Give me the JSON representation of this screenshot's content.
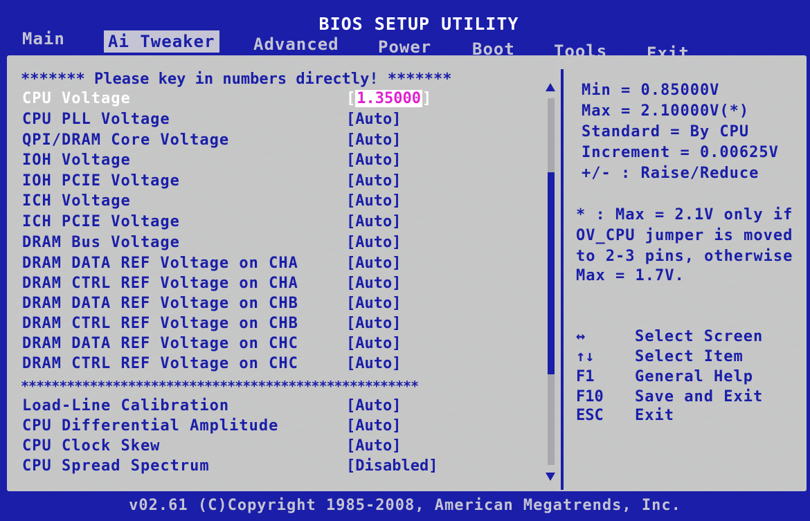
{
  "app": {
    "title": "BIOS SETUP UTILITY",
    "footer": "v02.61 (C)Copyright 1985-2008, American Megatrends, Inc."
  },
  "menu": {
    "items": [
      {
        "label": "Main"
      },
      {
        "label": "Ai Tweaker"
      },
      {
        "label": "Advanced"
      },
      {
        "label": "Power"
      },
      {
        "label": "Boot"
      },
      {
        "label": "Tools"
      },
      {
        "label": "Exit"
      }
    ],
    "active": "Ai Tweaker"
  },
  "settings": {
    "hint": "******* Please key in numbers directly! *******",
    "separator": "****************************************************",
    "voltage_rows": [
      {
        "label": "CPU Voltage",
        "value": "1.35000",
        "selected": true
      },
      {
        "label": "CPU PLL Voltage",
        "value": "[Auto]"
      },
      {
        "label": "QPI/DRAM Core Voltage",
        "value": "[Auto]"
      },
      {
        "label": "IOH Voltage",
        "value": "[Auto]"
      },
      {
        "label": "IOH PCIE Voltage",
        "value": "[Auto]"
      },
      {
        "label": "ICH Voltage",
        "value": "[Auto]"
      },
      {
        "label": "ICH PCIE Voltage",
        "value": "[Auto]"
      },
      {
        "label": "DRAM Bus Voltage",
        "value": "[Auto]"
      },
      {
        "label": "DRAM DATA REF Voltage on CHA",
        "value": "[Auto]"
      },
      {
        "label": "DRAM CTRL REF Voltage on CHA",
        "value": "[Auto]"
      },
      {
        "label": "DRAM DATA REF Voltage on CHB",
        "value": "[Auto]"
      },
      {
        "label": "DRAM CTRL REF Voltage on CHB",
        "value": "[Auto]"
      },
      {
        "label": "DRAM DATA REF Voltage on CHC",
        "value": "[Auto]"
      },
      {
        "label": "DRAM CTRL REF Voltage on CHC",
        "value": "[Auto]"
      }
    ],
    "other_rows": [
      {
        "label": "Load-Line Calibration",
        "value": "[Auto]"
      },
      {
        "label": "CPU Differential Amplitude",
        "value": "[Auto]"
      },
      {
        "label": "CPU Clock Skew",
        "value": "[Auto]"
      },
      {
        "label": "CPU Spread Spectrum",
        "value": "[Disabled]"
      }
    ],
    "scroll": {
      "visible_fraction": 0.55,
      "position_fraction": 0.45
    }
  },
  "help": {
    "info": [
      "Min = 0.85000V",
      "Max = 2.10000V(*)",
      "Standard  = By CPU",
      "Increment = 0.00625V",
      "+/- : Raise/Reduce"
    ],
    "note": [
      "* : Max = 2.1V only if",
      "OV_CPU jumper is moved",
      "to 2-3 pins, otherwise",
      "Max = 1.7V."
    ],
    "keys": [
      {
        "key": "↔",
        "desc": "Select Screen"
      },
      {
        "key": "↑↓",
        "desc": "Select Item"
      },
      {
        "key": "F1",
        "desc": "General Help"
      },
      {
        "key": "F10",
        "desc": "Save and Exit"
      },
      {
        "key": "ESC",
        "desc": "Exit"
      }
    ]
  },
  "colors": {
    "background": "#1a1ea8",
    "panel": "#c6c6c6",
    "highlight_text": "#ffffff",
    "edit_value": "#e020d0"
  }
}
